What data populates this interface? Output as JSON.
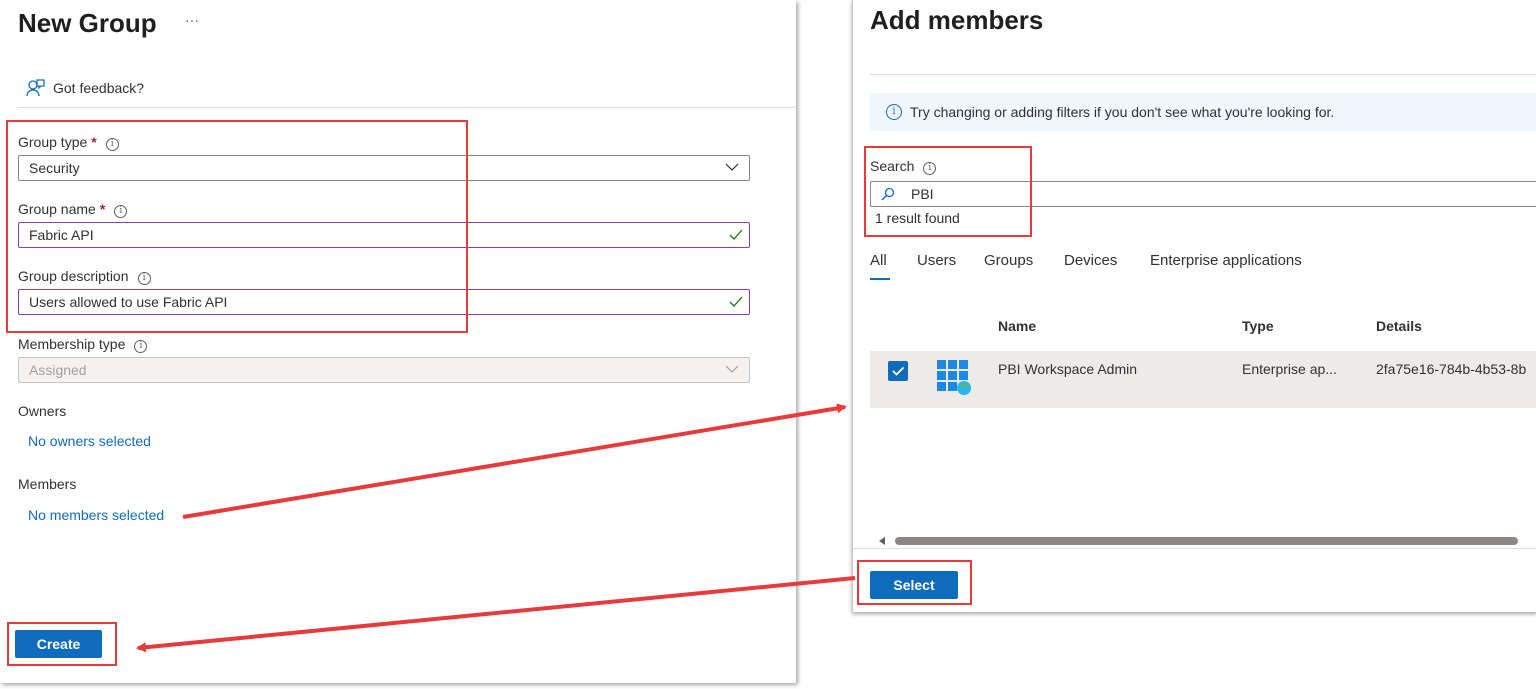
{
  "left": {
    "title": "New Group",
    "more": "···",
    "feedback": "Got feedback?",
    "group_type": {
      "label": "Group type",
      "required": "*",
      "value": "Security"
    },
    "group_name": {
      "label": "Group name",
      "required": "*",
      "value": "Fabric API"
    },
    "group_description": {
      "label": "Group description",
      "value": "Users allowed to use Fabric API"
    },
    "membership_type": {
      "label": "Membership type",
      "value": "Assigned"
    },
    "owners": {
      "label": "Owners",
      "link": "No owners selected"
    },
    "members": {
      "label": "Members",
      "link": "No members selected"
    },
    "create_label": "Create"
  },
  "right": {
    "title": "Add members",
    "info_banner": "Try changing or adding filters if you don't see what you're looking for.",
    "search": {
      "label": "Search",
      "value": "PBI",
      "result": "1 result found"
    },
    "tabs": [
      "All",
      "Users",
      "Groups",
      "Devices",
      "Enterprise applications"
    ],
    "active_tab": "All",
    "table": {
      "columns": [
        "Name",
        "Type",
        "Details"
      ],
      "rows": [
        {
          "name": "PBI Workspace Admin",
          "type": "Enterprise ap...",
          "details": "2fa75e16-784b-4b53-8b",
          "selected": true
        }
      ]
    },
    "select_label": "Select"
  },
  "colors": {
    "accent": "#0f6cbd",
    "highlight": "#e83a3a",
    "valid": "#8a3fb1"
  },
  "icons": [
    "feedback-icon",
    "info-icon",
    "chevron-down-icon",
    "checkmark-icon",
    "search-icon",
    "enterprise-app-icon"
  ]
}
